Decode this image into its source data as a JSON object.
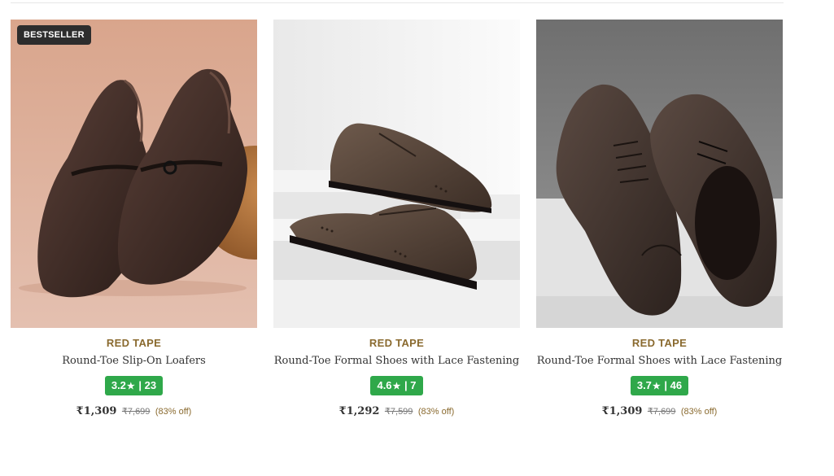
{
  "products": [
    {
      "badge": "BESTSELLER",
      "brand": "RED TAPE",
      "name": "Round-Toe Slip-On Loafers",
      "rating": "3.2",
      "rating_count": "23",
      "price": "₹1,309",
      "mrp": "₹7,699",
      "discount": "(83% off)",
      "image_icon": "brown-leather-loafers-image"
    },
    {
      "brand": "RED TAPE",
      "name": "Round-Toe Formal Shoes with Lace Fastening",
      "rating": "4.6",
      "rating_count": "7",
      "price": "₹1,292",
      "mrp": "₹7,599",
      "discount": "(83% off)",
      "image_icon": "brown-brogue-derby-shoes-image"
    },
    {
      "brand": "RED TAPE",
      "name": "Round-Toe Formal Shoes with Lace Fastening",
      "rating": "3.7",
      "rating_count": "46",
      "price": "₹1,309",
      "mrp": "₹7,699",
      "discount": "(83% off)",
      "image_icon": "brown-oxford-shoes-image"
    }
  ],
  "colors": {
    "brand_gold": "#8a6a2f",
    "rating_green": "#2fa84a",
    "badge_dark": "#2d2d2d"
  }
}
